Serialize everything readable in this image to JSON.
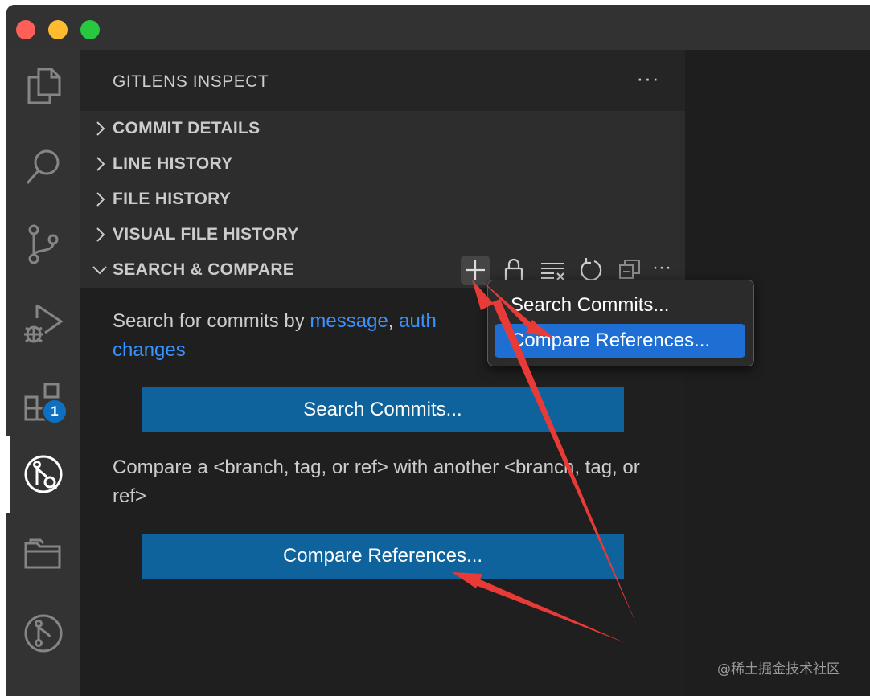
{
  "colors": {
    "accent_button": "#0e639c",
    "link": "#3794ff",
    "menu_selection": "#1f6ed4",
    "badge": "#0e70c0",
    "annotation_arrow": "#e83a36"
  },
  "activity_bar": {
    "items": [
      {
        "name": "explorer",
        "icon": "files-icon"
      },
      {
        "name": "search",
        "icon": "search-icon"
      },
      {
        "name": "source-control",
        "icon": "source-control-icon"
      },
      {
        "name": "run-and-debug",
        "icon": "run-debug-icon"
      },
      {
        "name": "extensions",
        "icon": "extensions-icon",
        "badge": "1"
      },
      {
        "name": "gitlens-inspect",
        "icon": "gitlens-inspect-icon",
        "active": true
      },
      {
        "name": "folders",
        "icon": "folders-icon"
      },
      {
        "name": "gitlens",
        "icon": "gitlens-icon"
      }
    ]
  },
  "sidebar": {
    "title": "GITLENS INSPECT",
    "more": "···",
    "sections": [
      {
        "label": "COMMIT DETAILS",
        "expanded": false
      },
      {
        "label": "LINE HISTORY",
        "expanded": false
      },
      {
        "label": "FILE HISTORY",
        "expanded": false
      },
      {
        "label": "VISUAL FILE HISTORY",
        "expanded": false
      },
      {
        "label": "SEARCH & COMPARE",
        "expanded": true
      }
    ],
    "section_tools": [
      "plus-icon",
      "lock-icon",
      "clear-all-icon",
      "refresh-icon",
      "collapse-all-icon",
      "more-icon"
    ],
    "section_tools_more": "···"
  },
  "search_compare": {
    "search_text": "Search for commits by ",
    "link_message": "message",
    "comma": ", ",
    "link_author": "auth",
    "link_changes": "changes",
    "search_button": "Search Commits...",
    "compare_text": "Compare a <branch, tag, or ref> with another <branch, tag, or ref>",
    "compare_button": "Compare References..."
  },
  "dropdown": {
    "items": [
      {
        "label": "Search Commits...",
        "selected": false
      },
      {
        "label": "Compare References...",
        "selected": true
      }
    ]
  },
  "watermark": "@稀土掘金技术社区"
}
